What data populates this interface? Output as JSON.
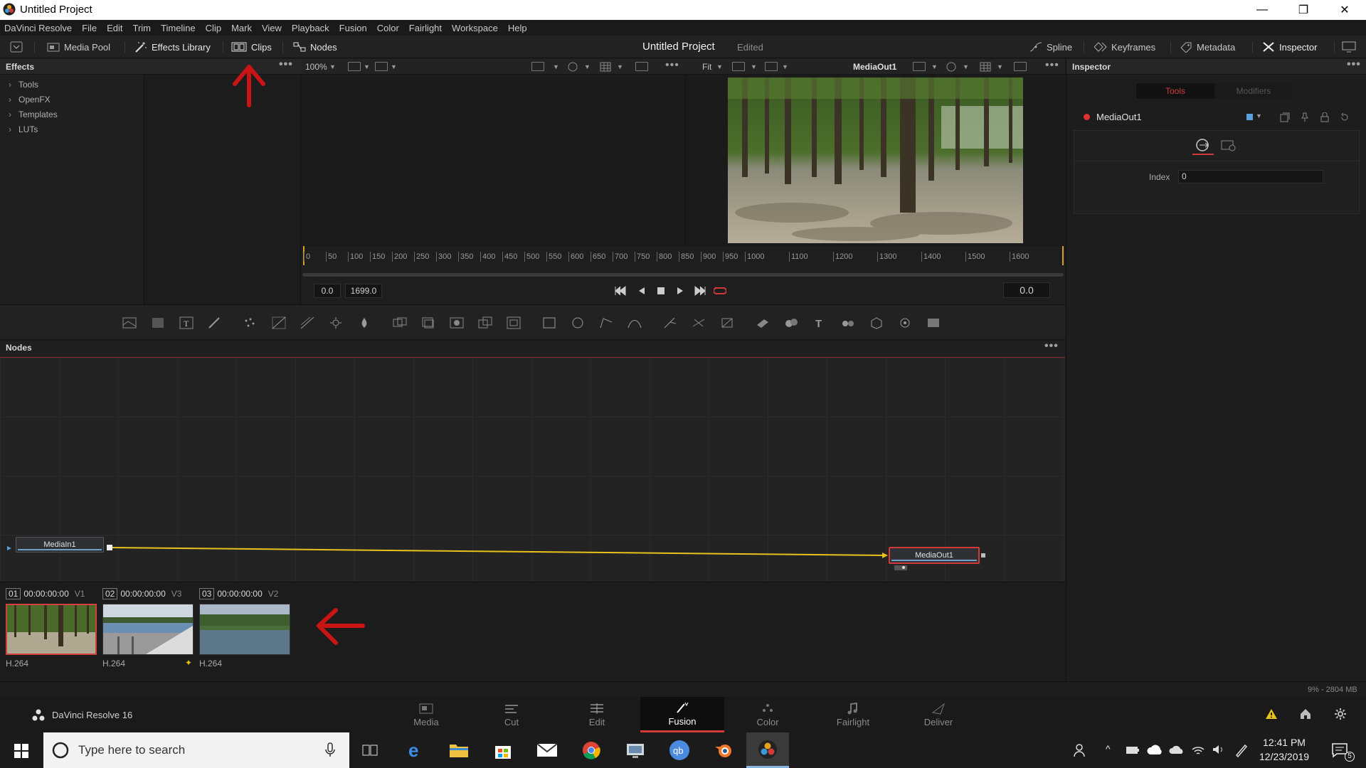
{
  "window": {
    "title": "Untitled Project",
    "min": "—",
    "max": "❐",
    "close": "✕"
  },
  "menu": [
    "DaVinci Resolve",
    "File",
    "Edit",
    "Trim",
    "Timeline",
    "Clip",
    "Mark",
    "View",
    "Playback",
    "Fusion",
    "Color",
    "Fairlight",
    "Workspace",
    "Help"
  ],
  "toolbar": {
    "media_pool": "Media Pool",
    "effects_library": "Effects Library",
    "clips": "Clips",
    "nodes": "Nodes",
    "project_title": "Untitled Project",
    "project_status": "Edited",
    "spline": "Spline",
    "keyframes": "Keyframes",
    "metadata": "Metadata",
    "inspector": "Inspector"
  },
  "effects": {
    "title": "Effects",
    "items": [
      "Tools",
      "OpenFX",
      "Templates",
      "LUTs"
    ]
  },
  "viewers": {
    "left_zoom": "100%",
    "right_fit": "Fit",
    "right_title": "MediaOut1"
  },
  "ruler": {
    "ticks": [
      "0",
      "50",
      "100",
      "150",
      "200",
      "250",
      "300",
      "350",
      "400",
      "450",
      "500",
      "550",
      "600",
      "650",
      "700",
      "750",
      "800",
      "850",
      "900",
      "950",
      "1000",
      "1100",
      "1200",
      "1300",
      "1400",
      "1500",
      "1600"
    ]
  },
  "transport": {
    "start_time": "0.0",
    "end_time": "1699.0",
    "current_time": "0.0"
  },
  "nodes": {
    "title": "Nodes",
    "input_node": "MediaIn1",
    "output_node": "MediaOut1"
  },
  "clips": [
    {
      "num": "01",
      "timecode": "00:00:00:00",
      "track": "V1",
      "codec": "H.264",
      "selected": true
    },
    {
      "num": "02",
      "timecode": "00:00:00:00",
      "track": "V3",
      "codec": "H.264",
      "selected": false
    },
    {
      "num": "03",
      "timecode": "00:00:00:00",
      "track": "V2",
      "codec": "H.264",
      "selected": false
    }
  ],
  "inspector": {
    "title": "Inspector",
    "tab_tools": "Tools",
    "tab_modifiers": "Modifiers",
    "node_name": "MediaOut1",
    "index_label": "Index",
    "index_value": "0"
  },
  "status": {
    "memory": "9% - 2804 MB"
  },
  "app": {
    "name": "DaVinci Resolve 16"
  },
  "pages": [
    {
      "label": "Media",
      "active": false
    },
    {
      "label": "Cut",
      "active": false
    },
    {
      "label": "Edit",
      "active": false
    },
    {
      "label": "Fusion",
      "active": true
    },
    {
      "label": "Color",
      "active": false
    },
    {
      "label": "Fairlight",
      "active": false
    },
    {
      "label": "Deliver",
      "active": false
    }
  ],
  "taskbar": {
    "search_placeholder": "Type here to search",
    "time": "12:41 PM",
    "date": "12/23/2019",
    "notifications": "5"
  },
  "colors": {
    "accent_red": "#d23a3a",
    "connection_line": "#e8c21a",
    "annotation_red": "#c81414"
  }
}
